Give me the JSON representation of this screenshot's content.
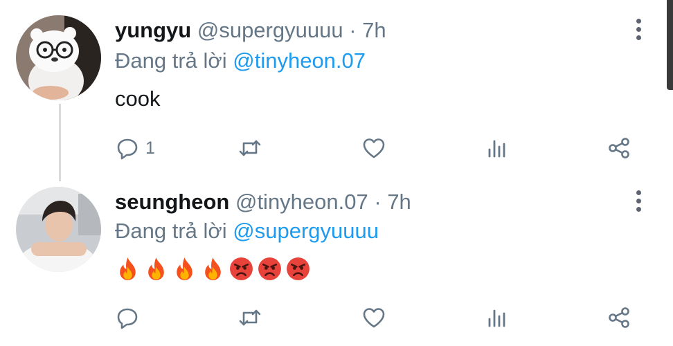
{
  "tweets": [
    {
      "name": "yungyu",
      "handle": "@supergyuuuu",
      "time": "7h",
      "reply_prefix": "Đang trả lời",
      "reply_to": "@tinyheon.07",
      "text": "cook",
      "counts": {
        "replies": "1"
      }
    },
    {
      "name": "seungheon",
      "handle": "@tinyheon.07",
      "time": "7h",
      "reply_prefix": "Đang trả lời",
      "reply_to": "@supergyuuuu",
      "emojis": [
        "fire",
        "fire",
        "fire",
        "fire",
        "angry-face",
        "angry-face",
        "angry-face"
      ]
    }
  ],
  "separator": " · ",
  "colors": {
    "accent": "#1d9bf0",
    "text": "#14171a",
    "muted": "#657786"
  }
}
